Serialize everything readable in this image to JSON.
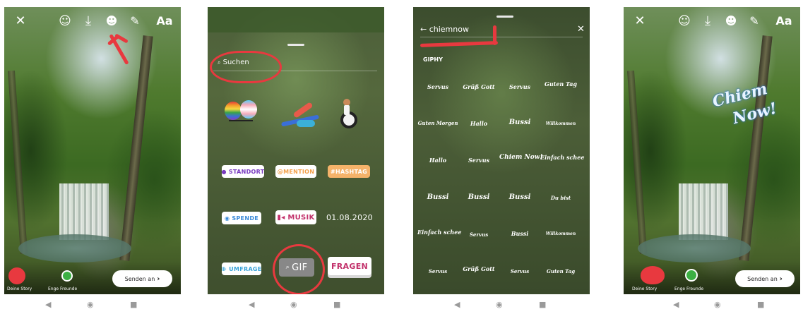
{
  "panel1": {
    "top_icons": [
      "close-icon",
      "face-effect-icon",
      "download-icon",
      "sticker-icon",
      "draw-icon"
    ],
    "text_tool_label": "Aa",
    "your_story_label": "Deine Story",
    "close_friends_label": "Enge Freunde",
    "send_label": "Senden an"
  },
  "panel2": {
    "search_label": "Suchen",
    "stickers": {
      "location": "STANDORT",
      "mention": "@MENTION",
      "hashtag": "#HASHTAG",
      "donate": "SPENDE",
      "music": "MUSIK",
      "date": "01.08.2020",
      "poll": "UMFRAGE",
      "gif": "GIF",
      "questions": "FRAGEN"
    }
  },
  "panel3": {
    "search_value": "chiemnow",
    "provider_label": "GIPHY",
    "gif_results": [
      [
        "Servus",
        "Grüß Gott",
        "Servus",
        "Guten Tag"
      ],
      [
        "Guten Morgen",
        "Hallo",
        "Bussi",
        "Willkommen"
      ],
      [
        "Hallo",
        "Servus",
        "Chiem Now!",
        "Einfach schee"
      ],
      [
        "Bussi",
        "Bussi",
        "Bussi",
        "Du bist"
      ],
      [
        "Einfach schee",
        "Servus",
        "Bussi",
        "Willkommen"
      ],
      [
        "Servus",
        "Grüß Gott",
        "Servus",
        "Guten Tag"
      ]
    ]
  },
  "panel4": {
    "top_icons": [
      "close-icon",
      "face-effect-icon",
      "download-icon",
      "sticker-icon",
      "draw-icon"
    ],
    "text_tool_label": "Aa",
    "placed_sticker_line1": "Chiem",
    "placed_sticker_line2": "Now!",
    "your_story_label": "Deine Story",
    "close_friends_label": "Enge Freunde",
    "send_label": "Senden an"
  },
  "nav_icons": [
    "back-icon",
    "home-icon",
    "recents-icon"
  ],
  "colors": {
    "annotation": "#e8393f",
    "close_friends": "#3cb043"
  }
}
